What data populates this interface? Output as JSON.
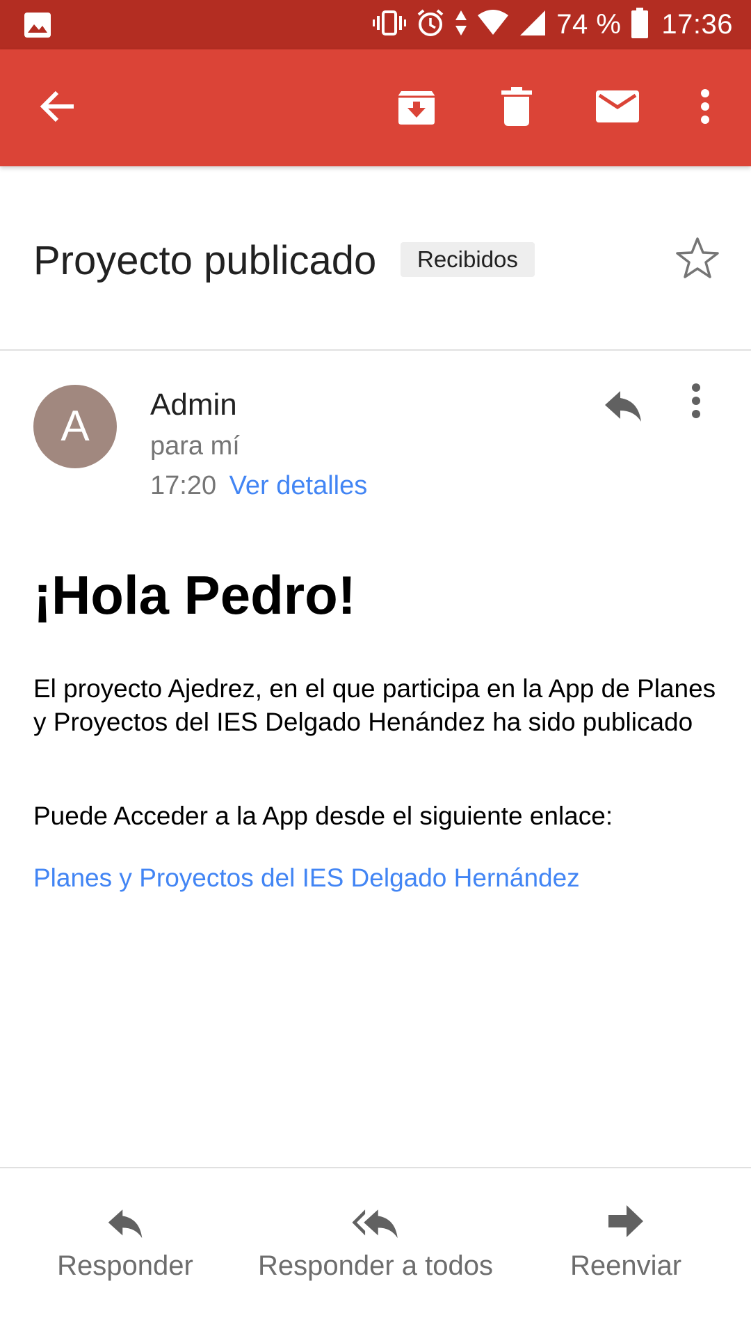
{
  "status_bar": {
    "battery": "74 %",
    "clock": "17:36",
    "icons": [
      "gallery-icon",
      "vibrate-icon",
      "alarm-icon",
      "data-arrows-icon",
      "wifi-icon",
      "cell-signal-icon",
      "battery-icon"
    ]
  },
  "app_bar": {
    "actions": [
      "back-arrow-icon",
      "archive-icon",
      "delete-icon",
      "mark-unread-icon",
      "more-vert-icon"
    ]
  },
  "email": {
    "subject": "Proyecto publicado",
    "label": "Recibidos",
    "sender": {
      "avatar_letter": "A",
      "name": "Admin",
      "recipient": "para mí",
      "time": "17:20",
      "details_link": "Ver detalles"
    },
    "body": {
      "heading": "¡Hola Pedro!",
      "paragraph1": "El proyecto Ajedrez, en el que participa en la App de Planes y Proyectos del IES Delgado Henández ha sido publicado",
      "paragraph2": "Puede Acceder a la App desde el siguiente enlace:",
      "link_text": "Planes y Proyectos del IES Delgado Hernández"
    }
  },
  "bottom_actions": {
    "reply": "Responder",
    "reply_all": "Responder a todos",
    "forward": "Reenviar"
  },
  "colors": {
    "status_bar": "#b32d22",
    "app_bar": "#db4437",
    "link": "#4285f4",
    "avatar": "#a1887f"
  }
}
